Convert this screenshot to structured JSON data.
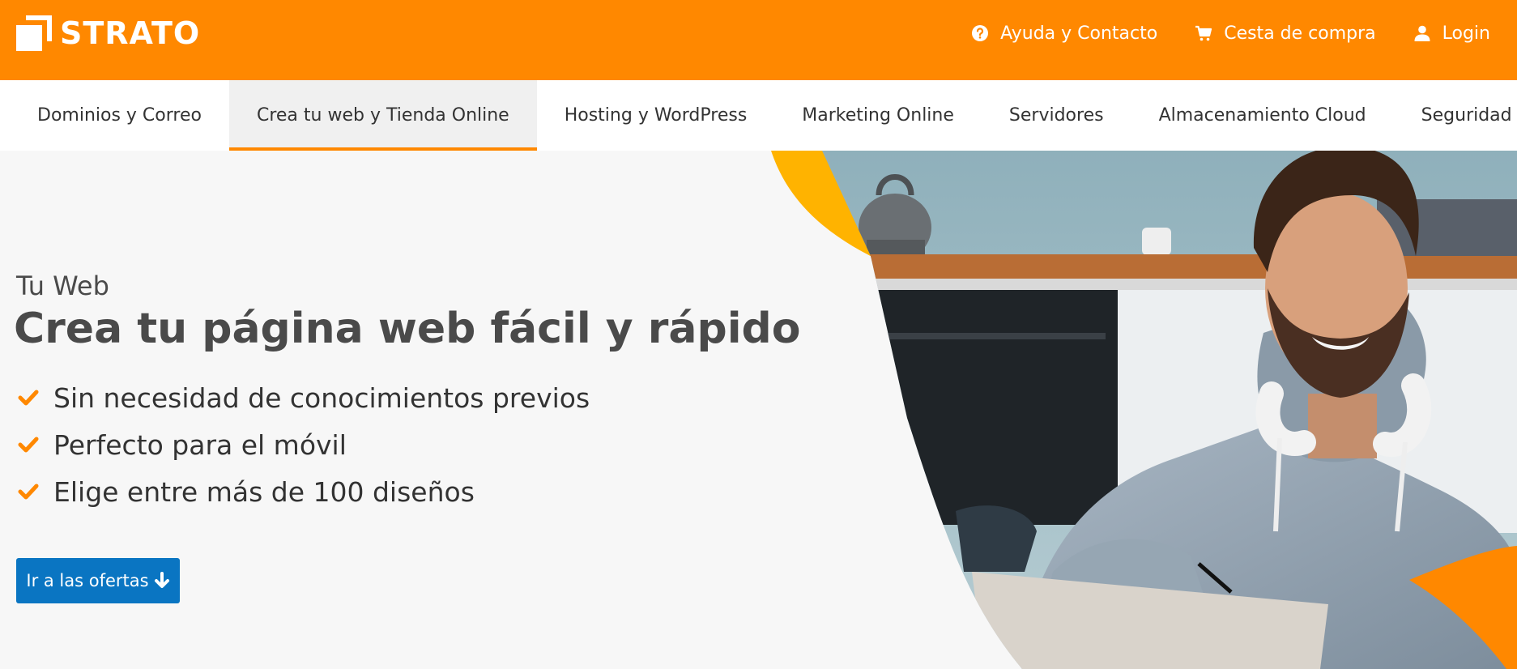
{
  "header": {
    "logo_text": "STRATO",
    "links": [
      {
        "label": "Ayuda y Contacto",
        "icon": "question-circle-icon"
      },
      {
        "label": "Cesta de compra",
        "icon": "cart-icon"
      },
      {
        "label": "Login",
        "icon": "user-icon"
      }
    ]
  },
  "nav": {
    "items": [
      {
        "label": "Dominios y Correo",
        "active": false
      },
      {
        "label": "Crea tu web y Tienda Online",
        "active": true
      },
      {
        "label": "Hosting y WordPress",
        "active": false
      },
      {
        "label": "Marketing Online",
        "active": false
      },
      {
        "label": "Servidores",
        "active": false
      },
      {
        "label": "Almacenamiento Cloud",
        "active": false
      },
      {
        "label": "Seguridad",
        "active": false
      }
    ]
  },
  "hero": {
    "eyebrow": "Tu Web",
    "headline": "Crea tu página web fácil y rápido",
    "features": [
      "Sin necesidad de conocimientos previos",
      "Perfecto para el móvil",
      "Elige entre más de 100 diseños"
    ],
    "cta_label": "Ir a las ofertas",
    "cta_icon": "arrow-down-icon",
    "image": "man-with-headphones-at-laptop-photo"
  },
  "colors": {
    "brand_orange": "#ff8800",
    "accent_yellow": "#ffb300",
    "cta_blue": "#0a75c2",
    "text_dark": "#4a4a4a",
    "hero_bg": "#f7f7f7"
  }
}
